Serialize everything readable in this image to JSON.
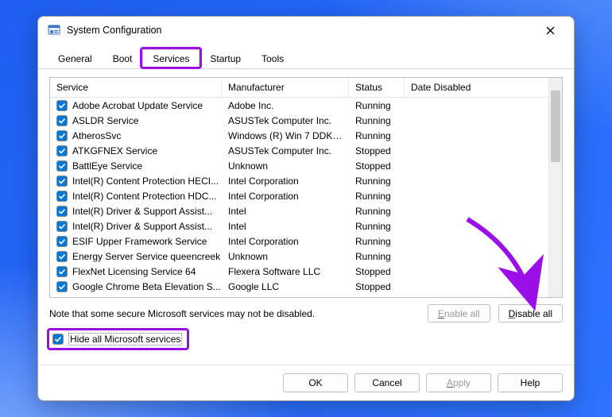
{
  "window": {
    "title": "System Configuration"
  },
  "tabs": [
    {
      "label": "General"
    },
    {
      "label": "Boot"
    },
    {
      "label": "Services",
      "active": true
    },
    {
      "label": "Startup"
    },
    {
      "label": "Tools"
    }
  ],
  "columns": {
    "service": "Service",
    "manufacturer": "Manufacturer",
    "status": "Status",
    "date_disabled": "Date Disabled"
  },
  "rows": [
    {
      "svc": "Adobe Acrobat Update Service",
      "mfr": "Adobe Inc.",
      "stat": "Running"
    },
    {
      "svc": "ASLDR Service",
      "mfr": "ASUSTek Computer Inc.",
      "stat": "Running"
    },
    {
      "svc": "AtherosSvc",
      "mfr": "Windows (R) Win 7 DDK p...",
      "stat": "Running"
    },
    {
      "svc": "ATKGFNEX Service",
      "mfr": "ASUSTek Computer Inc.",
      "stat": "Stopped"
    },
    {
      "svc": "BattlEye Service",
      "mfr": "Unknown",
      "stat": "Stopped"
    },
    {
      "svc": "Intel(R) Content Protection HECI...",
      "mfr": "Intel Corporation",
      "stat": "Running"
    },
    {
      "svc": "Intel(R) Content Protection HDC...",
      "mfr": "Intel Corporation",
      "stat": "Running"
    },
    {
      "svc": "Intel(R) Driver & Support Assist...",
      "mfr": "Intel",
      "stat": "Running"
    },
    {
      "svc": "Intel(R) Driver & Support Assist...",
      "mfr": "Intel",
      "stat": "Running"
    },
    {
      "svc": "ESIF Upper Framework Service",
      "mfr": "Intel Corporation",
      "stat": "Running"
    },
    {
      "svc": "Energy Server Service queencreek",
      "mfr": "Unknown",
      "stat": "Running"
    },
    {
      "svc": "FlexNet Licensing Service 64",
      "mfr": "Flexera Software LLC",
      "stat": "Stopped"
    },
    {
      "svc": "Google Chrome Beta Elevation S...",
      "mfr": "Google LLC",
      "stat": "Stopped"
    }
  ],
  "note": "Note that some secure Microsoft services may not be disabled.",
  "buttons": {
    "enable_all": "Enable all",
    "disable_all": "Disable all",
    "ok": "OK",
    "cancel": "Cancel",
    "apply": "Apply",
    "help": "Help"
  },
  "hide_all": {
    "label": "Hide all Microsoft services",
    "checked": true
  },
  "highlight_color": "#9a0fe6"
}
